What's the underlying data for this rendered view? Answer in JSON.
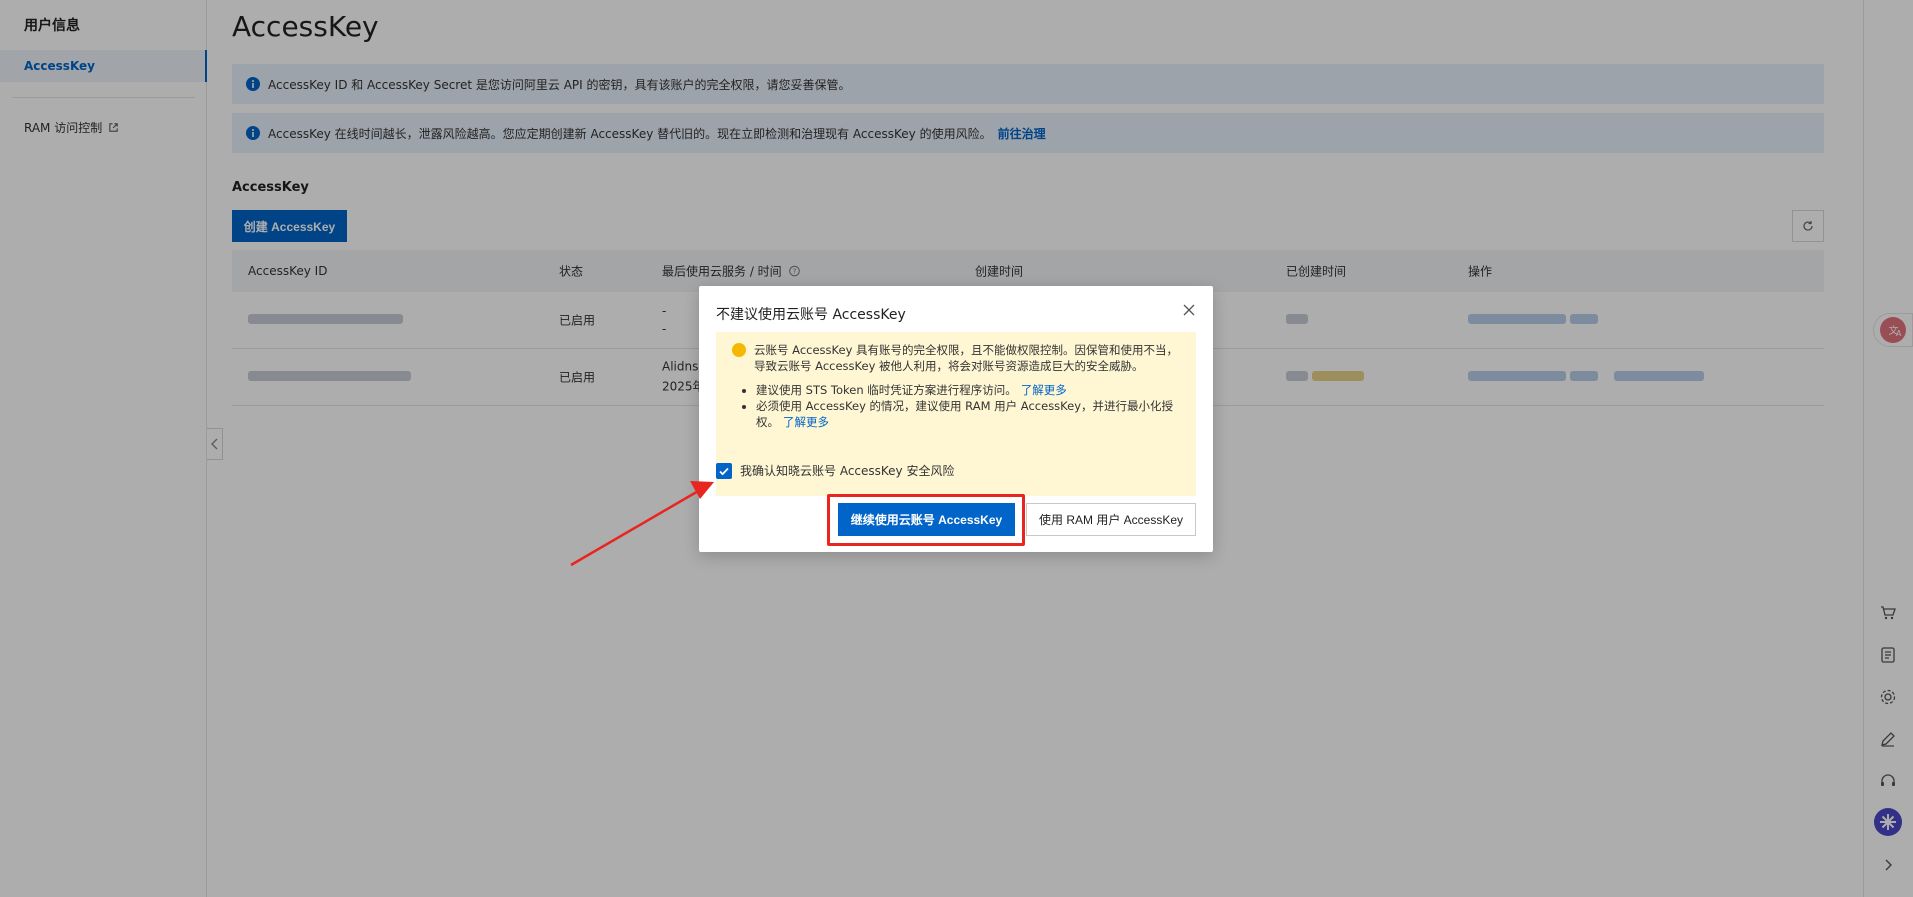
{
  "sidebar": {
    "title": "用户信息",
    "items": [
      {
        "label": "AccessKey"
      },
      {
        "label": "RAM 访问控制"
      }
    ]
  },
  "main": {
    "title": "AccessKey",
    "alert1": "AccessKey ID 和 AccessKey Secret 是您访问阿里云 API 的密钥，具有该账户的完全权限，请您妥善保管。",
    "alert2": "AccessKey 在线时间越长，泄露风险越高。您应定期创建新 AccessKey 替代旧的。现在立即检测和治理现有 AccessKey 的使用风险。",
    "alert2_link": "前往治理",
    "section_label": "AccessKey",
    "create_button": "创建 AccessKey",
    "table": {
      "headers": [
        "AccessKey ID",
        "状态",
        "最后使用云服务 / 时间",
        "创建时间",
        "已创建时间",
        "操作"
      ],
      "rows": [
        {
          "status": "已启用",
          "last_used_1": "-",
          "last_used_2": "-"
        },
        {
          "status": "已启用",
          "last_used_1": "Alidns",
          "last_used_2": "2025年"
        }
      ]
    }
  },
  "modal": {
    "title": "不建议使用云账号 AccessKey",
    "warning": "云账号 AccessKey 具有账号的完全权限，且不能做权限控制。因保管和使用不当，导致云账号 AccessKey 被他人利用，将会对账号资源造成巨大的安全威胁。",
    "tips": [
      {
        "text": "建议使用 STS Token 临时凭证方案进行程序访问。",
        "link": "了解更多"
      },
      {
        "text": "必须使用 AccessKey 的情况，建议使用 RAM 用户 AccessKey，并进行最小化授权。",
        "link": "了解更多"
      }
    ],
    "confirm_label": "我确认知晓云账号 AccessKey 安全风险",
    "primary_button": "继续使用云账号 AccessKey",
    "secondary_button": "使用 RAM 用户 AccessKey",
    "confirm_checked": true
  },
  "colors": {
    "primary": "#0064c8",
    "highlight": "#e8261f",
    "warning_bg": "#fff7d4"
  }
}
